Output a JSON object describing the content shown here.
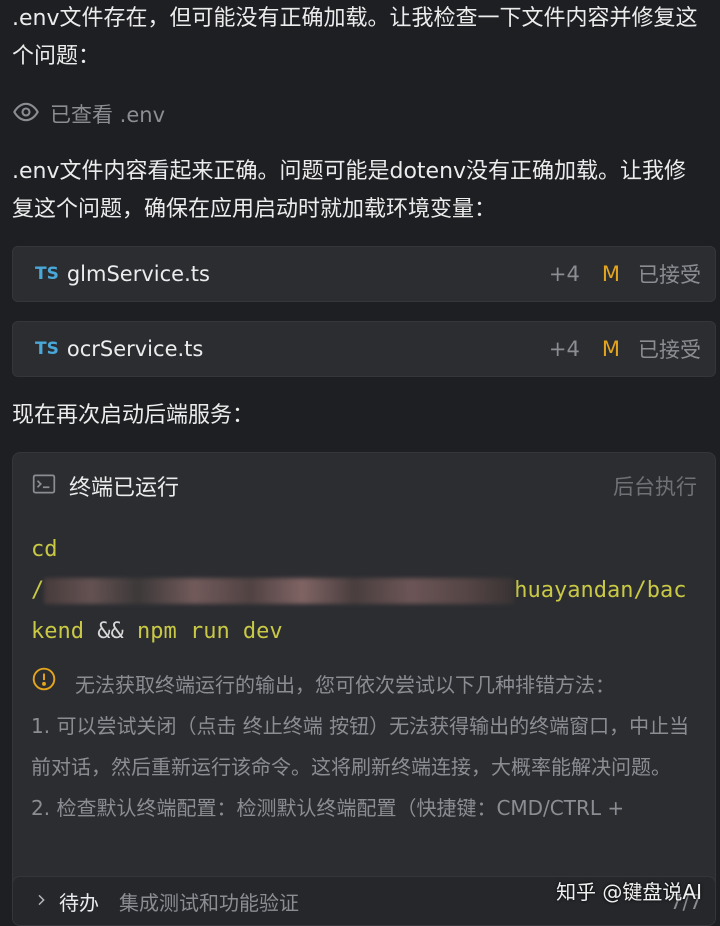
{
  "messages": {
    "para1": ".env文件存在，但可能没有正确加载。让我检查一下文件内容并修复这个问题：",
    "viewed_label": "已查看 .env",
    "para2": ".env文件内容看起来正确。问题可能是dotenv没有正确加载。让我修复这个问题，确保在应用启动时就加载环境变量：",
    "para3": "现在再次启动后端服务："
  },
  "files": [
    {
      "lang": "TS",
      "name": "glmService.ts",
      "diff": "+4",
      "status": "M",
      "state": "已接受"
    },
    {
      "lang": "TS",
      "name": "ocrService.ts",
      "diff": "+4",
      "status": "M",
      "state": "已接受"
    }
  ],
  "terminal": {
    "title": "终端已运行",
    "background_label": "后台执行",
    "cmd_cd": "cd",
    "cmd_path_start": "/",
    "cmd_path_end": "huayandan/bac",
    "cmd_line3_a": "kend",
    "cmd_line3_b": " && ",
    "cmd_line3_c": "npm run dev",
    "warning_line1": "无法获取终端运行的输出，您可依次尝试以下几种排错方法：",
    "warning_line2": "1. 可以尝试关闭（点击 终止终端 按钮）无法获得输出的终端窗口，中止当前对话，然后重新运行该命令。这将刷新终端连接，大概率能解决问题。",
    "warning_line3": "2. 检查默认终端配置：检测默认终端配置（快捷键：CMD/CTRL +"
  },
  "todo": {
    "label": "待办",
    "text": "集成测试和功能验证",
    "pager": "7/7"
  },
  "watermark": "知乎 @键盘说AI",
  "colors": {
    "accent_ts": "#4aa8d8",
    "modified": "#e3a51d",
    "command": "#c9c945",
    "background": "#1e1f22"
  }
}
